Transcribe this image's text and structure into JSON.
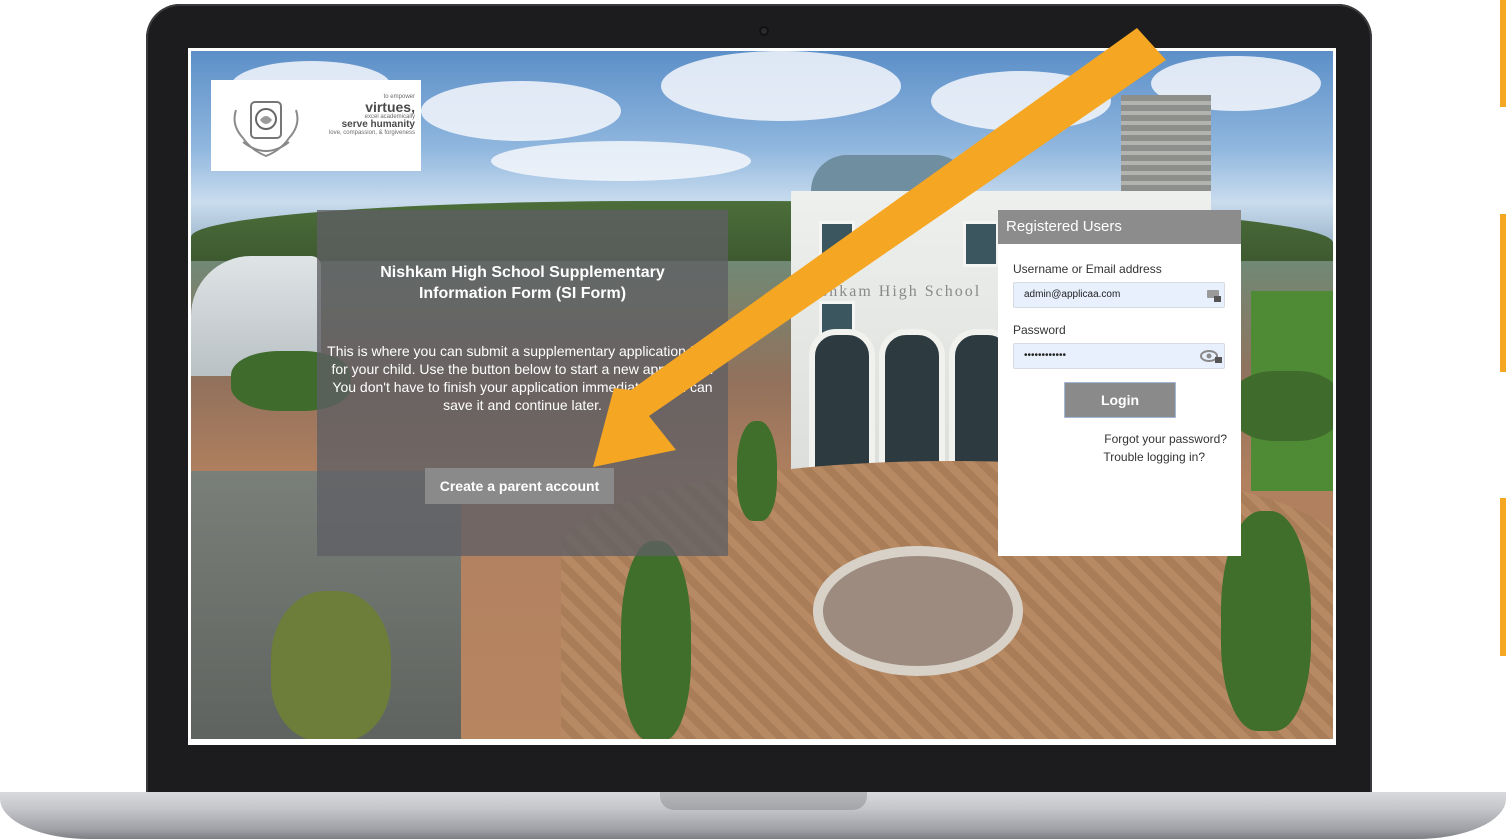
{
  "colors": {
    "accent_arrow": "#f5a623",
    "panel_grey": "#8c8c8c",
    "input_fill": "#e8f0fe"
  },
  "logo": {
    "motto_lines": [
      "to empower",
      "virtues,",
      "excel academically",
      "serve humanity",
      "love, compassion, & forgiveness"
    ]
  },
  "hero": {
    "title": "Nishkam High School Supplementary Information Form (SI Form)",
    "description": "This is where you can submit a supplementary application form for your child. Use the button below to start a new application. You don't have to finish your application immediately, you can save it and continue later.",
    "create_account_label": "Create a parent account"
  },
  "building_sign": "Nishkam High School",
  "login": {
    "header": "Registered Users",
    "username_label": "Username or Email address",
    "username_value": "admin@applicaa.com",
    "password_label": "Password",
    "password_value": "••••••••••••",
    "login_button": "Login",
    "forgot_password": "Forgot your password?",
    "trouble_logging_in": "Trouble logging in?"
  }
}
